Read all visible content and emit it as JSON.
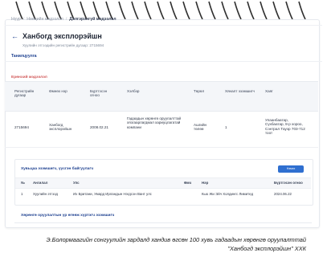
{
  "breadcrumb": {
    "home": "Нүүр",
    "middle": "Нөөцийн мэдээлэл",
    "current": "Дэлгэрэнгүй мэдээлэл"
  },
  "company": {
    "title": "Ханбогд эксплорэйшн",
    "registration_line": "Хуулийн этгээдийн регистрийн дугаар: 2715694"
  },
  "tabs": [
    "Танилцуулга"
  ],
  "section_general": {
    "title": "Ерөнхий мэдээлэл",
    "headers": [
      "Регистрийн дугаар",
      "Өмнөх нэр",
      "Бүртгэсэн огноо",
      "Хэлбэр",
      "Төрөл",
      "Хяналт эзэмшигч",
      "Хаяг"
    ],
    "row": {
      "registration": "2715694",
      "previous_name": "Ханбогд эксплорэйшн",
      "registered_date": "2008.02.21",
      "form": "Гадаадын хөрөнгө оруулалттай хязгаарлагдмал хариуцлагатай компани",
      "type": "Ашгийн төлөө",
      "controller": "1",
      "address": "Улаанбаатар, Сүхбаатар, 8-р хороо, Сэнтрал Тауэр 703-712 тоот"
    }
  },
  "section_owners": {
    "title": "Хувьцаа эзэмшигч, үүсгэн байгуулагч",
    "add_button": "Нэмэх",
    "headers": [
      "№",
      "Ангилал",
      "Улс",
      "Өмч",
      "Нэр",
      "Бүртгэсэн огноо"
    ],
    "rows": [
      {
        "num": "1",
        "category": "Хуулийн этгээд",
        "country": "Их Британи, Умард Ирландын Нэгдсэн Вант улс",
        "share": "",
        "name": "Кью Жи Эйч Холдингс Лимитед",
        "date": "2024.06.22"
      }
    ]
  },
  "section_beneficial": {
    "title": "Хөрөнгө оруулалтын үр өгөөж хүртэгч эзэмшигч"
  },
  "caption": {
    "line1": "Э.Болормаагийн сонгуулийн зардалд хандив өгсөн 100 хувь гадаадын хөрөнгө оруулалттай",
    "line2": "\"Ханбогд эксплорэйшн\" ХХК"
  }
}
